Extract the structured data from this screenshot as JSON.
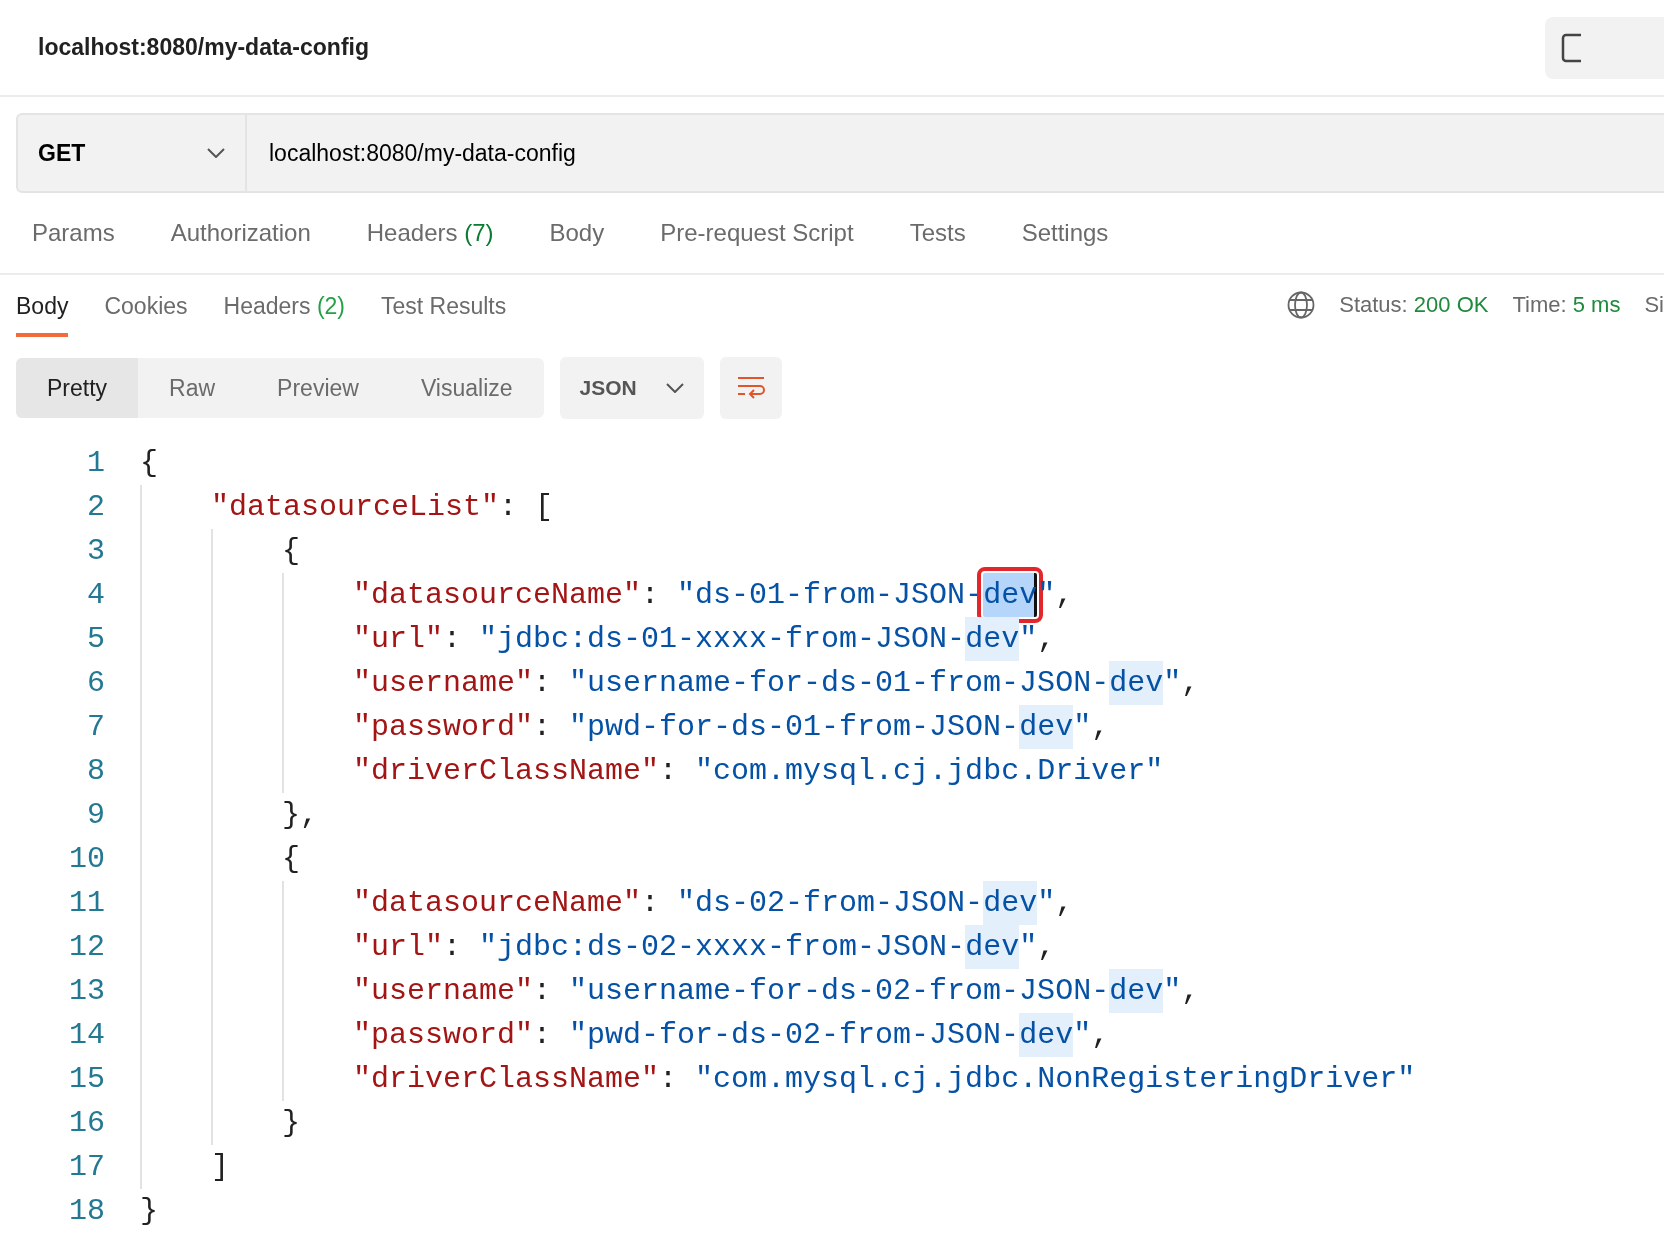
{
  "request_title": "localhost:8080/my-data-config",
  "request": {
    "method": "GET",
    "url": "localhost:8080/my-data-config"
  },
  "request_tabs": [
    {
      "label": "Params",
      "selected": false
    },
    {
      "label": "Authorization",
      "selected": false
    },
    {
      "label": "Headers",
      "count": "(7)",
      "selected": false
    },
    {
      "label": "Body",
      "selected": false
    },
    {
      "label": "Pre-request Script",
      "selected": false
    },
    {
      "label": "Tests",
      "selected": false
    },
    {
      "label": "Settings",
      "selected": false
    }
  ],
  "response_tabs": [
    {
      "label": "Body",
      "selected": true
    },
    {
      "label": "Cookies",
      "selected": false
    },
    {
      "label": "Headers",
      "count": "(2)",
      "selected": false
    },
    {
      "label": "Test Results",
      "selected": false
    }
  ],
  "response_status": [
    {
      "label": "Status:",
      "value": "200 OK"
    },
    {
      "label": "Time:",
      "value": "5 ms"
    },
    {
      "label": "Si"
    }
  ],
  "view_modes": [
    {
      "label": "Pretty",
      "selected": true
    },
    {
      "label": "Raw",
      "selected": false
    },
    {
      "label": "Preview",
      "selected": false
    },
    {
      "label": "Visualize",
      "selected": false
    }
  ],
  "format": "JSON",
  "code": [
    {
      "number": "1",
      "tokens": [
        {
          "text": "{",
          "kind": "punct"
        }
      ],
      "children": [
        {
          "number": "2",
          "tokens": [
            {
              "text": "\"datasourceList\"",
              "kind": "key"
            },
            {
              "text": ": [",
              "kind": "punct"
            }
          ],
          "children": [
            {
              "number": "3",
              "tokens": [
                {
                  "text": "{",
                  "kind": "punct"
                }
              ],
              "children": [
                {
                  "number": "4",
                  "tokens": [
                    {
                      "text": "\"datasourceName\"",
                      "kind": "key"
                    },
                    {
                      "text": ": ",
                      "kind": "punct"
                    },
                    {
                      "text": "\"ds-01-from-JSON-",
                      "kind": "string"
                    },
                    {
                      "text": "dev",
                      "kind": "string",
                      "match": true,
                      "selected": true
                    },
                    {
                      "text": "\"",
                      "kind": "string"
                    },
                    {
                      "text": ",",
                      "kind": "punct"
                    }
                  ]
                },
                {
                  "number": "5",
                  "tokens": [
                    {
                      "text": "\"url\"",
                      "kind": "key"
                    },
                    {
                      "text": ": ",
                      "kind": "punct"
                    },
                    {
                      "text": "\"jdbc:ds-01-xxxx-from-JSON-",
                      "kind": "string"
                    },
                    {
                      "text": "dev",
                      "kind": "string",
                      "match": true,
                      "selected": false
                    },
                    {
                      "text": "\"",
                      "kind": "string"
                    },
                    {
                      "text": ",",
                      "kind": "punct"
                    }
                  ]
                },
                {
                  "number": "6",
                  "tokens": [
                    {
                      "text": "\"username\"",
                      "kind": "key"
                    },
                    {
                      "text": ": ",
                      "kind": "punct"
                    },
                    {
                      "text": "\"username-for-ds-01-from-JSON-",
                      "kind": "string"
                    },
                    {
                      "text": "dev",
                      "kind": "string",
                      "match": true,
                      "selected": false
                    },
                    {
                      "text": "\"",
                      "kind": "string"
                    },
                    {
                      "text": ",",
                      "kind": "punct"
                    }
                  ]
                },
                {
                  "number": "7",
                  "tokens": [
                    {
                      "text": "\"password\"",
                      "kind": "key"
                    },
                    {
                      "text": ": ",
                      "kind": "punct"
                    },
                    {
                      "text": "\"pwd-for-ds-01-from-JSON-",
                      "kind": "string"
                    },
                    {
                      "text": "dev",
                      "kind": "string",
                      "match": true,
                      "selected": false
                    },
                    {
                      "text": "\"",
                      "kind": "string"
                    },
                    {
                      "text": ",",
                      "kind": "punct"
                    }
                  ]
                },
                {
                  "number": "8",
                  "tokens": [
                    {
                      "text": "\"driverClassName\"",
                      "kind": "key"
                    },
                    {
                      "text": ": ",
                      "kind": "punct"
                    },
                    {
                      "text": "\"com.mysql.cj.jdbc.Driver\"",
                      "kind": "string"
                    }
                  ]
                }
              ]
            },
            {
              "number": "9",
              "tokens": [
                {
                  "text": "},",
                  "kind": "punct"
                }
              ]
            },
            {
              "number": "10",
              "tokens": [
                {
                  "text": "{",
                  "kind": "punct"
                }
              ],
              "children": [
                {
                  "number": "11",
                  "tokens": [
                    {
                      "text": "\"datasourceName\"",
                      "kind": "key"
                    },
                    {
                      "text": ": ",
                      "kind": "punct"
                    },
                    {
                      "text": "\"ds-02-from-JSON-",
                      "kind": "string"
                    },
                    {
                      "text": "dev",
                      "kind": "string",
                      "match": true,
                      "selected": false
                    },
                    {
                      "text": "\"",
                      "kind": "string"
                    },
                    {
                      "text": ",",
                      "kind": "punct"
                    }
                  ]
                },
                {
                  "number": "12",
                  "tokens": [
                    {
                      "text": "\"url\"",
                      "kind": "key"
                    },
                    {
                      "text": ": ",
                      "kind": "punct"
                    },
                    {
                      "text": "\"jdbc:ds-02-xxxx-from-JSON-",
                      "kind": "string"
                    },
                    {
                      "text": "dev",
                      "kind": "string",
                      "match": true,
                      "selected": false
                    },
                    {
                      "text": "\"",
                      "kind": "string"
                    },
                    {
                      "text": ",",
                      "kind": "punct"
                    }
                  ]
                },
                {
                  "number": "13",
                  "tokens": [
                    {
                      "text": "\"username\"",
                      "kind": "key"
                    },
                    {
                      "text": ": ",
                      "kind": "punct"
                    },
                    {
                      "text": "\"username-for-ds-02-from-JSON-",
                      "kind": "string"
                    },
                    {
                      "text": "dev",
                      "kind": "string",
                      "match": true,
                      "selected": false
                    },
                    {
                      "text": "\"",
                      "kind": "string"
                    },
                    {
                      "text": ",",
                      "kind": "punct"
                    }
                  ]
                },
                {
                  "number": "14",
                  "tokens": [
                    {
                      "text": "\"password\"",
                      "kind": "key"
                    },
                    {
                      "text": ": ",
                      "kind": "punct"
                    },
                    {
                      "text": "\"pwd-for-ds-02-from-JSON-",
                      "kind": "string"
                    },
                    {
                      "text": "dev",
                      "kind": "string",
                      "match": true,
                      "selected": false
                    },
                    {
                      "text": "\"",
                      "kind": "string"
                    },
                    {
                      "text": ",",
                      "kind": "punct"
                    }
                  ]
                },
                {
                  "number": "15",
                  "tokens": [
                    {
                      "text": "\"driverClassName\"",
                      "kind": "key"
                    },
                    {
                      "text": ": ",
                      "kind": "punct"
                    },
                    {
                      "text": "\"com.mysql.cj.jdbc.NonRegisteringDriver\"",
                      "kind": "string"
                    }
                  ]
                }
              ]
            },
            {
              "number": "16",
              "tokens": [
                {
                  "text": "}",
                  "kind": "punct"
                }
              ]
            }
          ]
        },
        {
          "number": "17",
          "tokens": [
            {
              "text": "]",
              "kind": "punct"
            }
          ]
        }
      ]
    },
    {
      "number": "18",
      "tokens": [
        {
          "text": "}",
          "kind": "punct"
        }
      ]
    }
  ]
}
